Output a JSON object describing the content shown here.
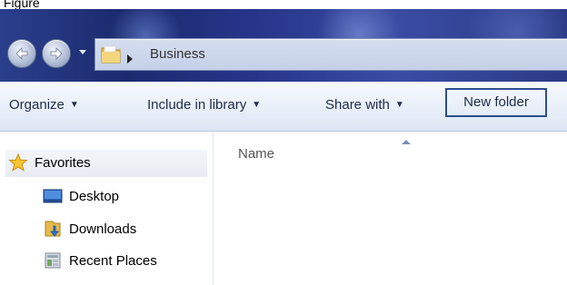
{
  "caption": "Figure",
  "window": {
    "breadcrumb": [
      "Business"
    ]
  },
  "toolbar": {
    "organize_label": "Organize",
    "include_label": "Include in library",
    "share_label": "Share with",
    "new_folder_label": "New folder"
  },
  "nav_pane": {
    "items": [
      {
        "label": "Favorites",
        "icon": "star-icon"
      },
      {
        "label": "Desktop",
        "icon": "desktop-icon"
      },
      {
        "label": "Downloads",
        "icon": "downloads-folder-icon"
      },
      {
        "label": "Recent Places",
        "icon": "recent-places-icon"
      }
    ]
  },
  "content": {
    "columns": [
      "Name"
    ]
  },
  "colors": {
    "highlight_border": "#2e4f8d",
    "title_bar": "#1b2a6e"
  }
}
